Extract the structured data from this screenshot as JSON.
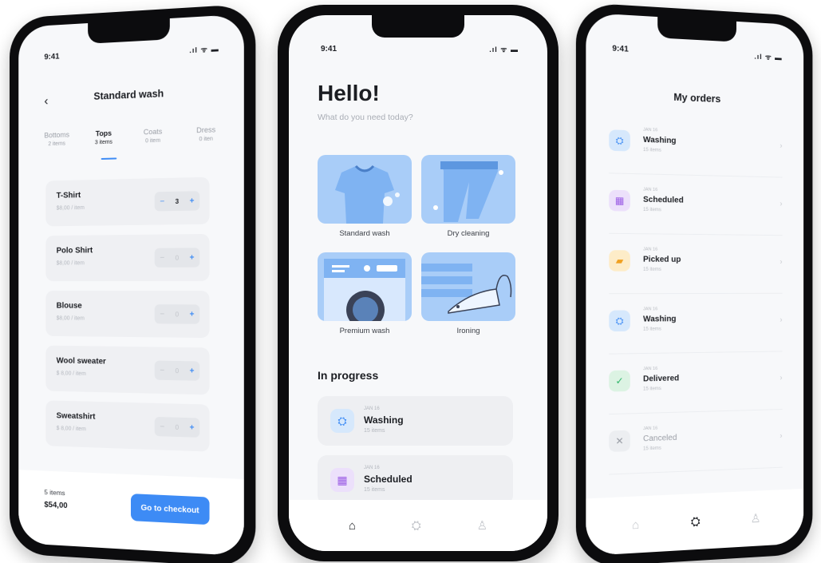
{
  "colors": {
    "accent": "#3d8bf5",
    "illustration": "#a9cdf8",
    "card": "#eff0f3"
  },
  "status_time": "9:41",
  "left": {
    "title": "Standard wash",
    "categories": [
      {
        "name": "Bottoms",
        "count": "2 items"
      },
      {
        "name": "Tops",
        "count": "3 items"
      },
      {
        "name": "Coats",
        "count": "0 item"
      },
      {
        "name": "Dress",
        "count": "0 iten"
      }
    ],
    "items": [
      {
        "name": "T-Shirt",
        "price": "$8,00 / item",
        "qty": "3"
      },
      {
        "name": "Polo Shirt",
        "price": "$8,00 / item",
        "qty": "0"
      },
      {
        "name": "Blouse",
        "price": "$8,00 / item",
        "qty": "0"
      },
      {
        "name": "Wool sweater",
        "price": "$ 8,00 / item",
        "qty": "0"
      },
      {
        "name": "Sweatshirt",
        "price": "$ 8,00 / item",
        "qty": "0"
      }
    ],
    "stepper": {
      "minus": "−",
      "plus": "+"
    },
    "summary_count": "5 items",
    "summary_total": "$54,00",
    "checkout": "Go to checkout"
  },
  "center": {
    "hello": "Hello!",
    "subtitle": "What do you need today?",
    "services": [
      {
        "label": "Standard wash",
        "icon": "tshirt-icon"
      },
      {
        "label": "Dry cleaning",
        "icon": "jeans-icon"
      },
      {
        "label": "Premium wash",
        "icon": "washing-machine-icon"
      },
      {
        "label": "Ironing",
        "icon": "iron-icon"
      }
    ],
    "section": "In progress",
    "progress": [
      {
        "date": "JAN 16",
        "status": "Washing",
        "count": "15 items",
        "icon": "basket-icon",
        "color": "#d6e8fc",
        "glyph": "⛭"
      },
      {
        "date": "JAN 16",
        "status": "Scheduled",
        "count": "15 items",
        "icon": "calendar-icon",
        "color": "#ece0fb",
        "glyph": "▦"
      }
    ],
    "tabs": [
      "home-icon",
      "basket-icon",
      "profile-icon"
    ]
  },
  "right": {
    "title": "My orders",
    "orders": [
      {
        "date": "JAN 16",
        "status": "Washing",
        "count": "15 items",
        "icon": "basket-icon",
        "color": "#d6e8fc",
        "glyph": "⛭",
        "fg": "#3d8bf5"
      },
      {
        "date": "JAN 16",
        "status": "Scheduled",
        "count": "15 items",
        "icon": "calendar-icon",
        "color": "#ece0fb",
        "glyph": "▦",
        "fg": "#9b5de5"
      },
      {
        "date": "JAN 16",
        "status": "Picked up",
        "count": "15 items",
        "icon": "truck-icon",
        "color": "#fdecc8",
        "glyph": "▰",
        "fg": "#f0a020"
      },
      {
        "date": "JAN 16",
        "status": "Washing",
        "count": "15 items",
        "icon": "basket-icon",
        "color": "#d6e8fc",
        "glyph": "⛭",
        "fg": "#3d8bf5"
      },
      {
        "date": "JAN 16",
        "status": "Delivered",
        "count": "15 items",
        "icon": "check-icon",
        "color": "#dcf3e3",
        "glyph": "✓",
        "fg": "#2fb66a"
      },
      {
        "date": "JAN 16",
        "status": "Canceled",
        "count": "15 items",
        "icon": "close-icon",
        "color": "#eceef1",
        "glyph": "✕",
        "fg": "#9a9ea6"
      }
    ]
  }
}
